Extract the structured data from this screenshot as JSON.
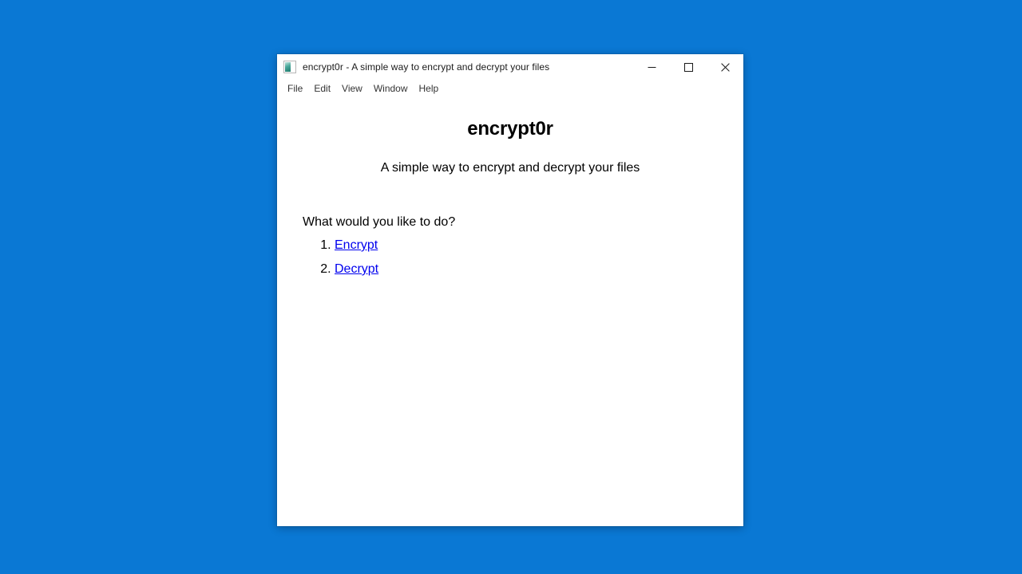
{
  "desktop": {
    "background_color": "#0a78d4"
  },
  "window": {
    "title": "encrypt0r - A simple way to encrypt and decrypt your files",
    "icon": "application-icon",
    "controls": {
      "minimize_label": "Minimize",
      "maximize_label": "Maximize",
      "close_label": "Close"
    }
  },
  "menubar": {
    "items": [
      {
        "label": "File"
      },
      {
        "label": "Edit"
      },
      {
        "label": "View"
      },
      {
        "label": "Window"
      },
      {
        "label": "Help"
      }
    ]
  },
  "content": {
    "heading": "encrypt0r",
    "subtitle": "A simple way to encrypt and decrypt your files",
    "prompt": "What would you like to do?",
    "actions": [
      {
        "label": "Encrypt"
      },
      {
        "label": "Decrypt"
      }
    ],
    "link_color": "#0000ee",
    "text_color": "#000000"
  }
}
